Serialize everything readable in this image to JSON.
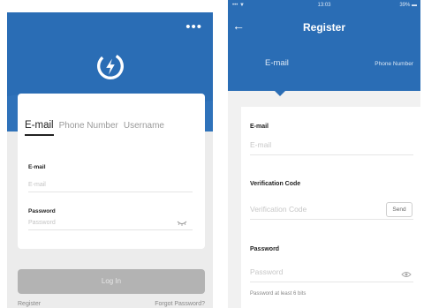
{
  "login": {
    "more_label": "•••",
    "tabs": [
      "E-mail",
      "Phone Number",
      "Username"
    ],
    "email_label": "E-mail",
    "email_placeholder": "E-mail",
    "password_label": "Password",
    "password_placeholder": "Password",
    "login_button": "Log In",
    "register_link": "Register",
    "forgot_link": "Forgot Password?"
  },
  "register": {
    "status": {
      "left": "••• ▼",
      "time": "13:03",
      "battery": "39%"
    },
    "back_glyph": "←",
    "title": "Register",
    "tabs": [
      "E-mail",
      "Phone Number"
    ],
    "email_label": "E-mail",
    "email_placeholder": "E-mail",
    "code_label": "Verification Code",
    "code_placeholder": "Verification Code",
    "send_button": "Send",
    "password_label": "Password",
    "password_placeholder": "Password",
    "password_hint": "Password at least 6 bits"
  },
  "colors": {
    "brand_blue": "#2a6db5",
    "disabled_button": "#b3b3b3"
  }
}
